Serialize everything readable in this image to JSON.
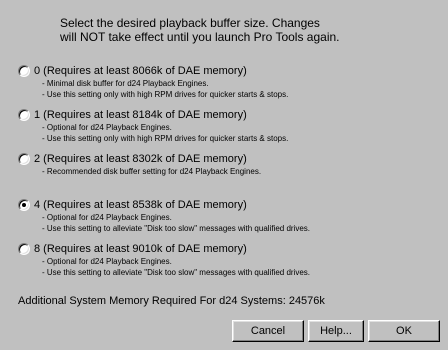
{
  "header": {
    "line1": "Select the desired playback buffer size.  Changes",
    "line2": "will NOT take effect until you launch Pro Tools again."
  },
  "options": [
    {
      "label": "0 (Requires at least 8066k of DAE memory)",
      "notes": [
        "- Minimal disk buffer for d24 Playback Engines.",
        "- Use this setting only with high RPM drives for quicker starts & stops."
      ],
      "selected": false
    },
    {
      "label": "1 (Requires at least 8184k of DAE memory)",
      "notes": [
        "- Optional for d24 Playback Engines.",
        "- Use this setting only with high RPM drives for quicker starts & stops."
      ],
      "selected": false
    },
    {
      "label": "2 (Requires at least 8302k of DAE memory)",
      "notes": [
        "- Recommended disk buffer setting for d24 Playback Engines."
      ],
      "selected": false
    },
    {
      "label": "4 (Requires at least 8538k of DAE memory)",
      "notes": [
        "- Optional for d24 Playback Engines.",
        "- Use this setting to alleviate \"Disk too slow\" messages with qualified drives."
      ],
      "selected": true
    },
    {
      "label": "8 (Requires at least 9010k of DAE memory)",
      "notes": [
        "- Optional for d24 Playback Engines.",
        "- Use this setting to alleviate \"Disk too slow\" messages with qualified drives."
      ],
      "selected": false
    }
  ],
  "summary": "Additional System Memory Required For d24 Systems: 24576k",
  "buttons": {
    "cancel": "Cancel",
    "help": "Help...",
    "ok": "OK"
  }
}
